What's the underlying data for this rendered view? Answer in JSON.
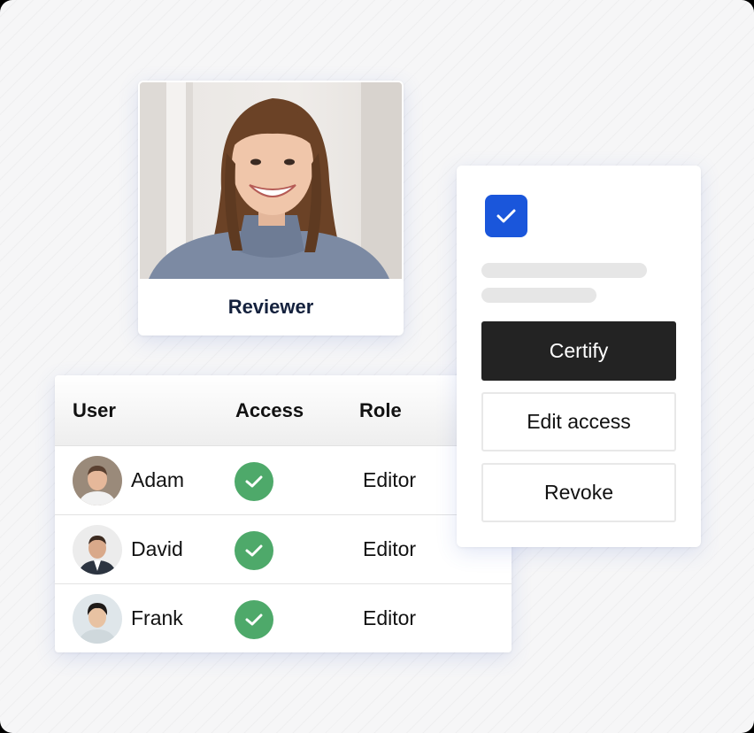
{
  "reviewer": {
    "label": "Reviewer"
  },
  "table": {
    "headers": [
      "User",
      "Access",
      "Role"
    ],
    "rows": [
      {
        "user": "Adam",
        "access": "check-circle-icon",
        "role": "Editor"
      },
      {
        "user": "David",
        "access": "check-circle-icon",
        "role": "Editor"
      },
      {
        "user": "Frank",
        "access": "check-circle-icon",
        "role": "Editor"
      }
    ]
  },
  "actions": {
    "checkbox_checked": true,
    "certify_label": "Certify",
    "edit_access_label": "Edit access",
    "revoke_label": "Revoke"
  },
  "colors": {
    "accent_blue": "#1a56db",
    "check_green": "#4ea96a",
    "primary_button": "#232323",
    "reviewer_text": "#14213d"
  }
}
